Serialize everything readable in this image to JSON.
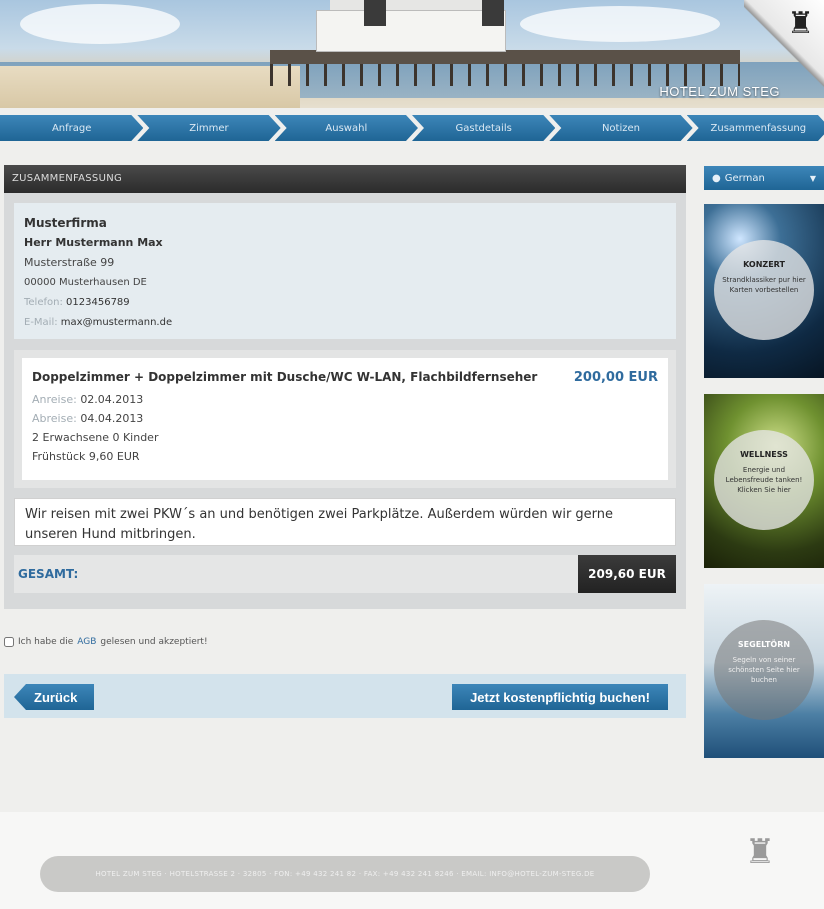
{
  "header": {
    "brand": "HOTEL ZUM STEG"
  },
  "steps": [
    "Anfrage",
    "Zimmer",
    "Auswahl",
    "Gastdetails",
    "Notizen",
    "Zusammenfassung"
  ],
  "summary": {
    "title": "ZUSAMMENFASSUNG",
    "company": "Musterfirma",
    "person": "Herr Mustermann Max",
    "street": "Musterstraße 99",
    "city": "00000 Musterhausen DE",
    "phone_label": "Telefon:",
    "phone": "0123456789",
    "email_label": "E-Mail:",
    "email": "max@mustermann.de"
  },
  "room": {
    "title": "Doppelzimmer + Doppelzimmer mit Dusche/WC W-LAN, Flachbildfernseher",
    "price": "200,00 EUR",
    "arrival_label": "Anreise:",
    "arrival": "02.04.2013",
    "departure_label": "Abreise:",
    "departure": "04.04.2013",
    "guests": "2 Erwachsene 0 Kinder",
    "breakfast": "Frühstück 9,60 EUR"
  },
  "notes": "Wir reisen mit zwei PKW´s an und benötigen zwei Parkplätze. Außerdem würden wir gerne unseren Hund mitbringen.",
  "total": {
    "label": "GESAMT:",
    "value": "209,60 EUR"
  },
  "agb": {
    "before": "Ich habe die",
    "link": "AGB",
    "after": "gelesen und akzeptiert!"
  },
  "actions": {
    "back": "Zurück",
    "book": "Jetzt kostenpflichtig buchen!"
  },
  "language": {
    "selected": "German"
  },
  "promos": [
    {
      "title": "KONZERT",
      "text": "Strandklassiker pur hier Karten vorbestellen"
    },
    {
      "title": "WELLNESS",
      "text": "Energie und Lebensfreude tanken! Klicken Sie hier"
    },
    {
      "title": "SEGELTÖRN",
      "text": "Segeln von seiner schönsten Seite hier buchen"
    }
  ],
  "footer": {
    "text": "HOTEL ZUM STEG · HOTELSTRASSE 2 · 32805 · FON: +49 432 241 82 · FAX: +49 432 241 8246 · EMAIL: INFO@HOTEL-ZUM-STEG.DE"
  },
  "colors": {
    "accent": "#1f6595",
    "dark": "#2b2b2b",
    "price": "#2f6b9e"
  }
}
